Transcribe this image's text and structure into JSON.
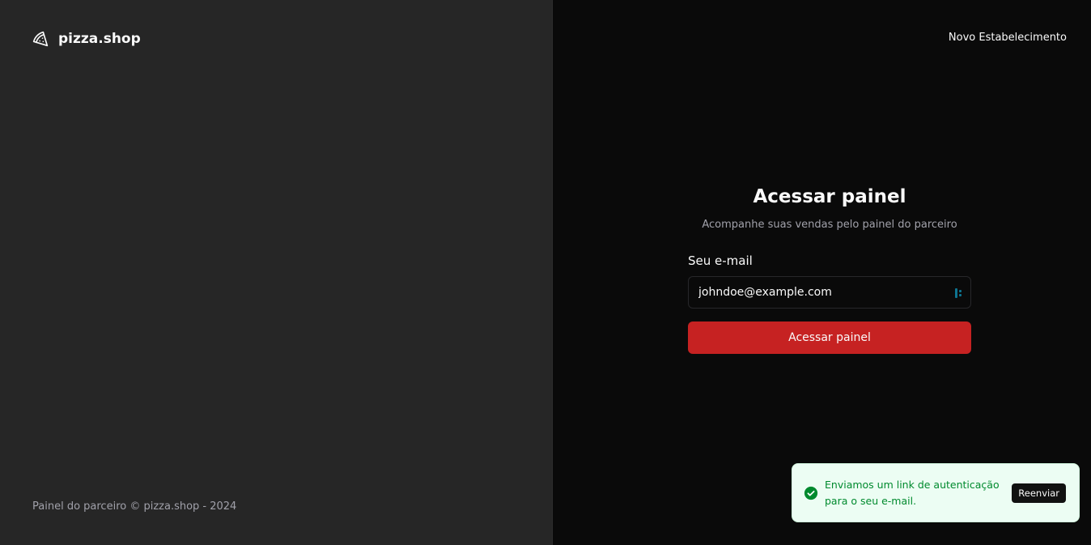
{
  "brand": {
    "name": "pizza.shop",
    "icon": "pizza-slice-icon"
  },
  "footer": {
    "text": "Painel do parceiro © pizza.shop - 2024"
  },
  "header": {
    "new_link": "Novo Estabelecimento"
  },
  "form": {
    "title": "Acessar painel",
    "subtitle": "Acompanhe suas vendas pelo painel do parceiro",
    "email_label": "Seu e-mail",
    "email_value": "johndoe@example.com",
    "submit_label": "Acessar painel"
  },
  "toast": {
    "message": "Enviamos um link de autenticação para o seu e-mail.",
    "action_label": "Reenviar",
    "icon": "check-circle-icon"
  },
  "colors": {
    "left_panel": "#262626",
    "right_panel": "#0a0a0a",
    "accent": "#c62222",
    "toast_bg": "#ecfdf3",
    "toast_text": "#008a2e"
  }
}
